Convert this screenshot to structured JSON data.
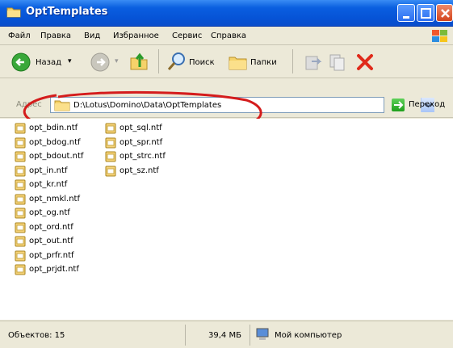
{
  "window": {
    "title": "OptTemplates",
    "title_icon": "folder-icon"
  },
  "menu": {
    "items": [
      "Файл",
      "Правка",
      "Вид",
      "Избранное",
      "Сервис",
      "Справка"
    ]
  },
  "toolbar": {
    "back_label": "Назад",
    "search_label": "Поиск",
    "folders_label": "Папки"
  },
  "address": {
    "label": "Адрес",
    "path": "D:\\Lotus\\Domino\\Data\\OptTemplates",
    "go_label": "Переход",
    "highlight_color": "#d41c1c"
  },
  "files": [
    "opt_bdin.ntf",
    "opt_bdog.ntf",
    "opt_bdout.ntf",
    "opt_in.ntf",
    "opt_kr.ntf",
    "opt_nmkl.ntf",
    "opt_og.ntf",
    "opt_ord.ntf",
    "opt_out.ntf",
    "opt_prfr.ntf",
    "opt_prjdt.ntf",
    "opt_sql.ntf",
    "opt_spr.ntf",
    "opt_strc.ntf",
    "opt_sz.ntf"
  ],
  "status": {
    "objects": "Объектов: 15",
    "size": "39,4 МБ",
    "location": "Мой компьютер"
  },
  "colors": {
    "titlebar": "#0a5fe0",
    "chrome": "#ece9d8",
    "close_button": "#d3441c"
  }
}
